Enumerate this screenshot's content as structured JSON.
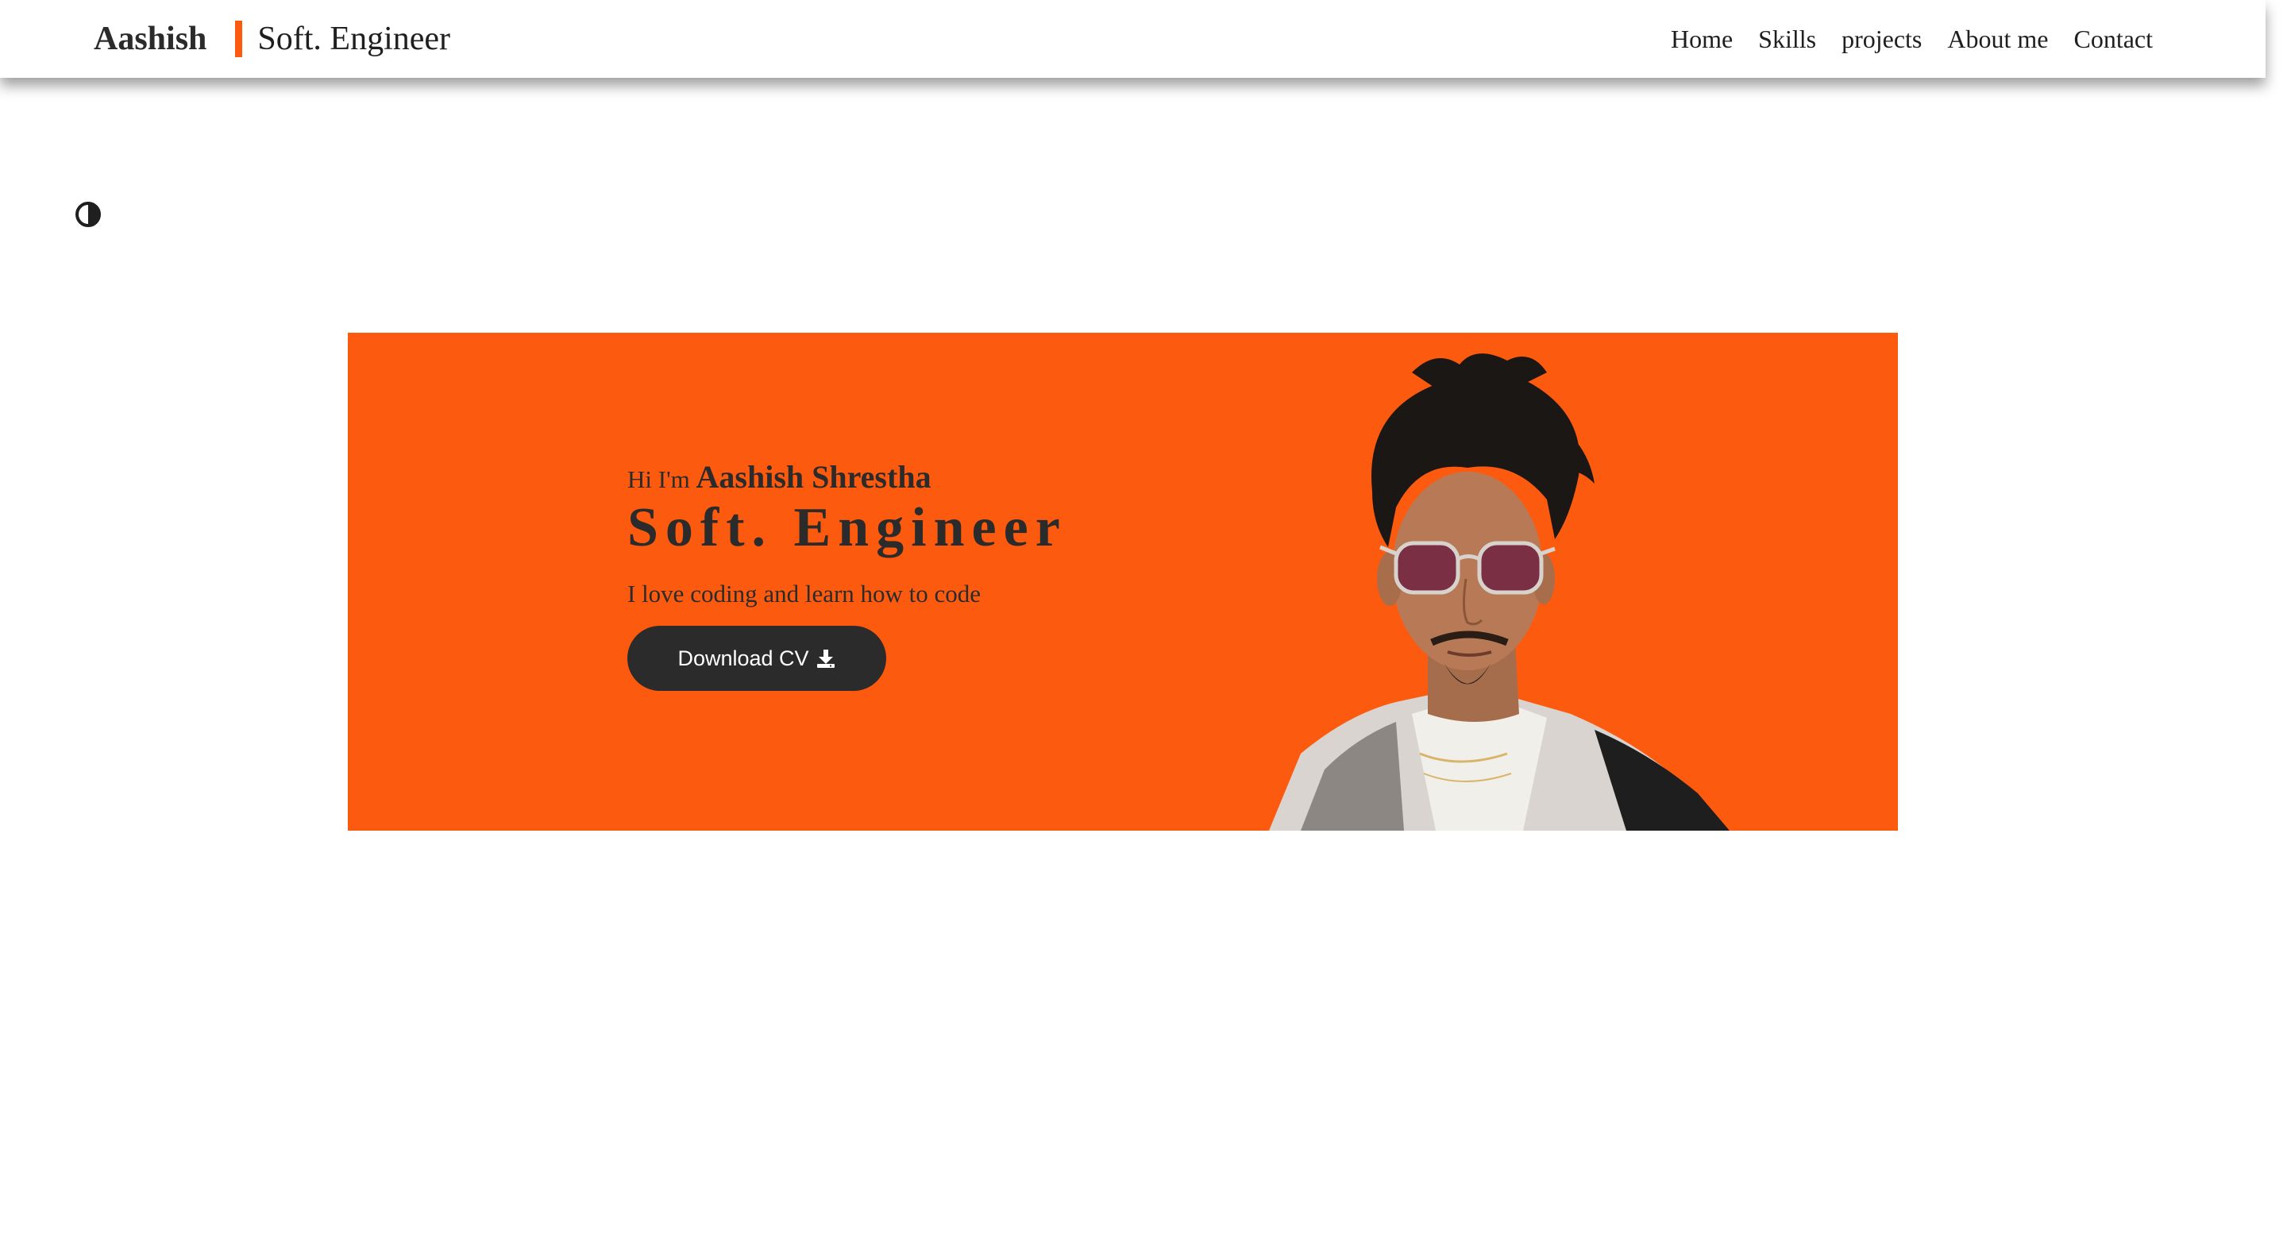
{
  "header": {
    "brand_name": "Aashish",
    "brand_role": "Soft. Engineer",
    "accent_color": "#fc5a0e",
    "nav": [
      {
        "label": "Home"
      },
      {
        "label": "Skills"
      },
      {
        "label": "projects"
      },
      {
        "label": "About me"
      },
      {
        "label": "Contact"
      }
    ]
  },
  "theme_toggle": {
    "icon": "half-circle-contrast-icon"
  },
  "hero": {
    "background_color": "#fc5a0e",
    "greeting_prefix": "Hi I'm",
    "name": "Aashish Shrestha",
    "title": "Soft. Engineer",
    "tagline": "I love coding and learn how to code",
    "cta_label": "Download CV",
    "cta_icon": "download-icon",
    "portrait_icon": "portrait-photo"
  }
}
